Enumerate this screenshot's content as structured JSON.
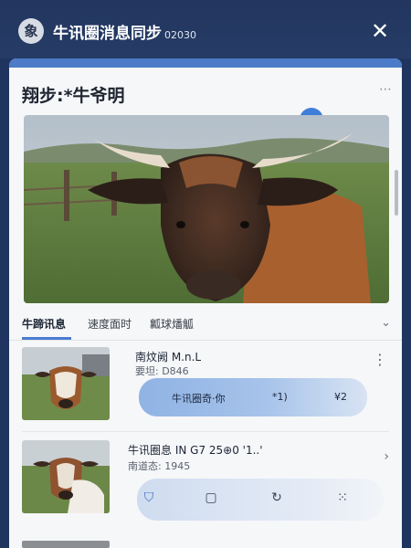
{
  "header": {
    "app_icon": "象",
    "title": "牛讯圈消息同步",
    "code": "02030",
    "close_label": "✕"
  },
  "card": {
    "title": "翔步:*牛爷明",
    "more_label": "⋯"
  },
  "tabs": {
    "items": [
      "牛蹄讯息",
      "速度面时",
      "瓤球燔觚"
    ],
    "chevron": "⌄"
  },
  "items": [
    {
      "name": "南炆阙 M.n.L",
      "sub": "要坦: D846",
      "bubble_left": "牛讯圈奇·你",
      "bubble_mid": "*1)",
      "bubble_right": "¥2",
      "menu": "⋮"
    },
    {
      "name": "牛讯圈息 IN G7 25⊕0 '1..'",
      "sub": "南道态: 1945",
      "chevron": "›",
      "action_icons": [
        "shield-icon",
        "copy-icon",
        "refresh-icon",
        "grid-icon"
      ]
    }
  ],
  "colors": {
    "header_bg": "#22365e",
    "accent": "#4a7dd0",
    "card_bg": "#f6f7f9"
  }
}
